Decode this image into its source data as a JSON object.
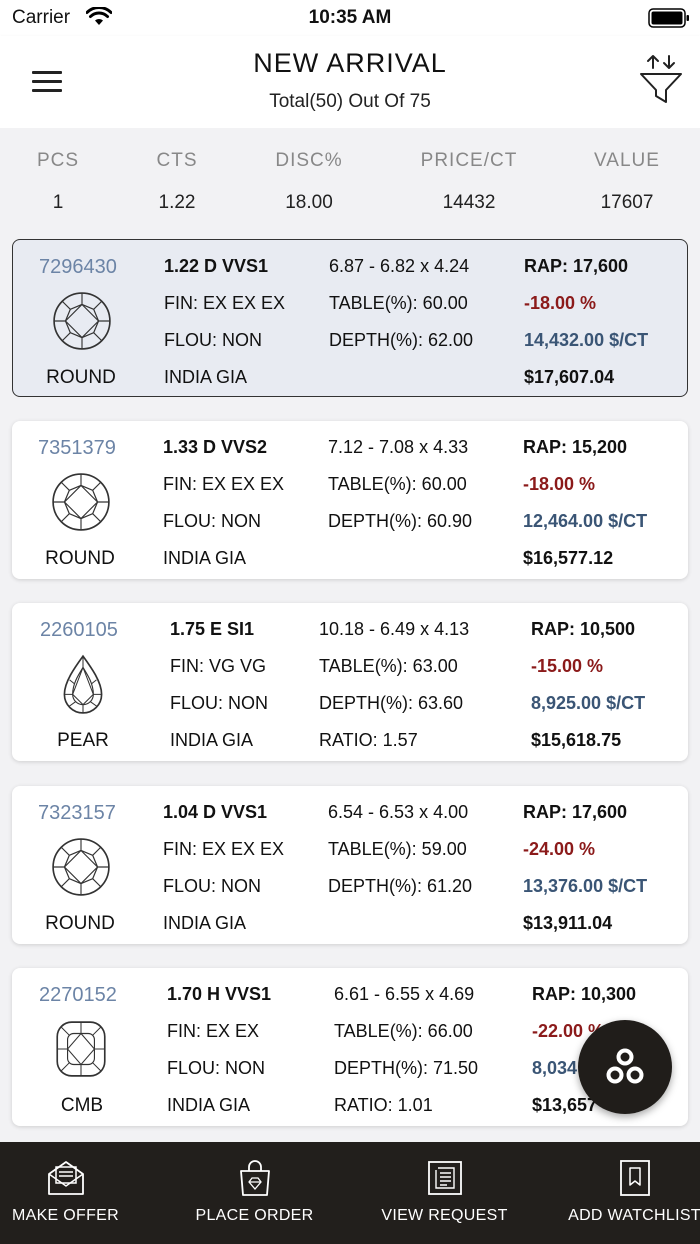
{
  "status": {
    "carrier": "Carrier",
    "time": "10:35 AM"
  },
  "header": {
    "title": "NEW ARRIVAL",
    "subtitle": "Total(50) Out Of 75"
  },
  "summary": {
    "pcs_label": "PCS",
    "pcs": "1",
    "cts_label": "CTS",
    "cts": "1.22",
    "disc_label": "DISC%",
    "disc": "18.00",
    "price_label": "PRICE/CT",
    "price": "14432",
    "value_label": "VALUE",
    "value": "17607"
  },
  "stones": [
    {
      "id": "7296430",
      "shape": "ROUND",
      "spec": "1.22  D  VVS1",
      "fin": "FIN: EX EX EX",
      "flou": "FLOU: NON",
      "loc": "INDIA  GIA",
      "measure": "6.87 - 6.82 x 4.24",
      "table": "TABLE(%): 60.00",
      "depth": "DEPTH(%): 62.00",
      "extra": "",
      "rap": "RAP: 17,600",
      "disc": "-18.00 %",
      "ppc": "14,432.00 $/CT",
      "total": "$17,607.04"
    },
    {
      "id": "7351379",
      "shape": "ROUND",
      "spec": "1.33  D  VVS2",
      "fin": "FIN: EX EX EX",
      "flou": "FLOU: NON",
      "loc": "INDIA  GIA",
      "measure": "7.12 - 7.08 x 4.33",
      "table": "TABLE(%): 60.00",
      "depth": "DEPTH(%): 60.90",
      "extra": "",
      "rap": "RAP: 15,200",
      "disc": "-18.00 %",
      "ppc": "12,464.00 $/CT",
      "total": "$16,577.12"
    },
    {
      "id": "2260105",
      "shape": "PEAR",
      "spec": "1.75  E  SI1",
      "fin": "FIN:  VG VG",
      "flou": "FLOU: NON",
      "loc": "INDIA  GIA",
      "measure": "10.18 - 6.49 x 4.13",
      "table": "TABLE(%): 63.00",
      "depth": "DEPTH(%): 63.60",
      "extra": "RATIO: 1.57",
      "rap": "RAP: 10,500",
      "disc": "-15.00 %",
      "ppc": "8,925.00 $/CT",
      "total": "$15,618.75"
    },
    {
      "id": "7323157",
      "shape": "ROUND",
      "spec": "1.04  D  VVS1",
      "fin": "FIN: EX EX EX",
      "flou": "FLOU: NON",
      "loc": "INDIA  GIA",
      "measure": "6.54 - 6.53 x 4.00",
      "table": "TABLE(%): 59.00",
      "depth": "DEPTH(%): 61.20",
      "extra": "",
      "rap": "RAP: 17,600",
      "disc": "-24.00 %",
      "ppc": "13,376.00 $/CT",
      "total": "$13,911.04"
    },
    {
      "id": "2270152",
      "shape": "CMB",
      "spec": "1.70  H  VVS1",
      "fin": "FIN:  EX EX",
      "flou": "FLOU: NON",
      "loc": "INDIA  GIA",
      "measure": "6.61 - 6.55 x 4.69",
      "table": "TABLE(%): 66.00",
      "depth": "DEPTH(%): 71.50",
      "extra": "RATIO: 1.01",
      "rap": "RAP: 10,300",
      "disc": "-22.00 %",
      "ppc": "8,034",
      "total": "$13,657"
    }
  ],
  "bottom": {
    "make_offer": "MAKE OFFER",
    "place_order": "PLACE ORDER",
    "view_request": "VIEW REQUEST",
    "add_watchlist": "ADD WATCHLIST"
  },
  "colors": {
    "stone_id": "#6c84a6",
    "discount": "#8b1a1a",
    "price_ct": "#3a5575",
    "bottom_bar": "#221f1c",
    "selected_card": "#e8ebf2"
  }
}
